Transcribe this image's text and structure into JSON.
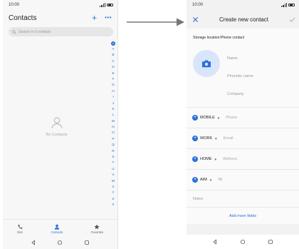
{
  "left": {
    "status": {
      "time": "10:00"
    },
    "header": {
      "title": "Contacts",
      "add_icon": "plus-icon",
      "more_icon": "more-icon"
    },
    "search": {
      "placeholder": "Search in 0 contacts"
    },
    "index_letters": [
      "#",
      "A",
      "B",
      "C",
      "D",
      "E",
      "F",
      "G",
      "H",
      "I",
      "J",
      "K",
      "L",
      "M",
      "N",
      "O",
      "P",
      "Q",
      "R",
      "S",
      "T",
      "U",
      "V",
      "W",
      "X",
      "Y",
      "Z",
      "#"
    ],
    "empty_text": "No Contacts",
    "tabs": [
      {
        "label": "Dial",
        "icon": "phone-icon",
        "active": false
      },
      {
        "label": "Contacts",
        "icon": "person-icon",
        "active": true
      },
      {
        "label": "Favorites",
        "icon": "star-icon",
        "active": false
      }
    ]
  },
  "right": {
    "status": {
      "time": "10:00"
    },
    "header": {
      "title": "Create new contact",
      "close_icon": "close-icon",
      "confirm_icon": "check-icon"
    },
    "storage": "Storage location:Phone contact",
    "name_fields": [
      "Name",
      "Phonetic name",
      "Company"
    ],
    "rows": [
      {
        "label": "MOBILE",
        "placeholder": "Phone"
      },
      {
        "label": "WORK",
        "placeholder": "Email"
      },
      {
        "label": "HOME",
        "placeholder": "Address"
      },
      {
        "label": "AIM",
        "placeholder": "IM"
      }
    ],
    "notes": "Notes",
    "add_more": "Add more fields"
  },
  "colors": {
    "accent": "#2a6fdb",
    "photo_bg": "#d8e5fa"
  }
}
